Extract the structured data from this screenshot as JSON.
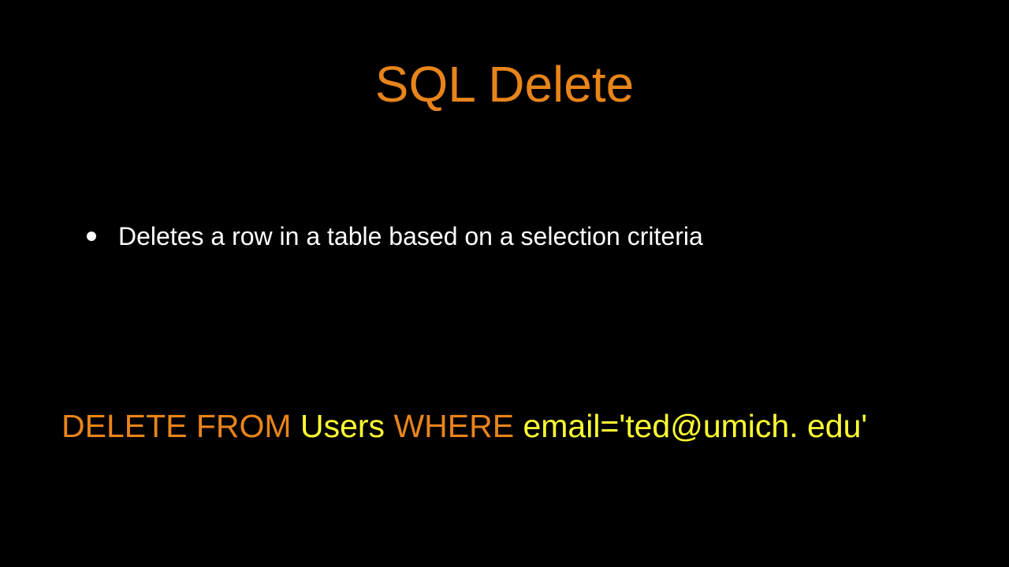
{
  "title": "SQL Delete",
  "bullet": "Deletes a row in a table based on a selection criteria",
  "code": {
    "kw1": "DELETE FROM",
    "val1": " Users ",
    "kw2": "WHERE",
    "val2": " email='ted@umich. edu'"
  }
}
